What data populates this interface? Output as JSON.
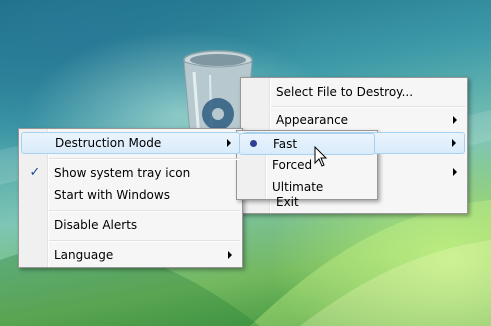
{
  "main_menu": {
    "items": {
      "destruction_mode": "Destruction Mode",
      "show_tray_icon": "Show system tray icon",
      "start_with_windows": "Start with Windows",
      "disable_alerts": "Disable Alerts",
      "language": "Language"
    },
    "checked": [
      "show_tray_icon"
    ]
  },
  "tray_menu": {
    "items": {
      "select_file": "Select File to Destroy...",
      "appearance": "Appearance",
      "exit": "Exit"
    }
  },
  "mode_submenu": {
    "items": [
      "Fast",
      "Forced",
      "Ultimate"
    ],
    "selected": "Fast"
  },
  "colors": {
    "highlight_border": "#a8d1f0",
    "menu_background": "#f6f6f6",
    "check_color": "#1c4a99"
  }
}
